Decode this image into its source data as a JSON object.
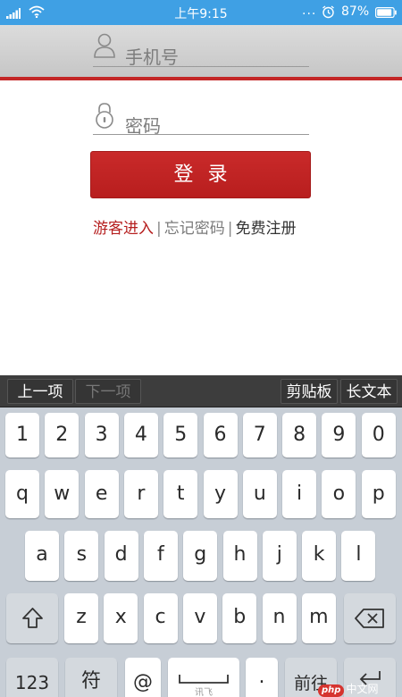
{
  "status_bar": {
    "time": "上午9:15",
    "dots": "...",
    "battery": "87%"
  },
  "form": {
    "phone_placeholder": "手机号",
    "password_placeholder": "密码",
    "login_label": "登录",
    "guest_link": "游客进入",
    "separator": "|",
    "forgot_link": "忘记密码",
    "register_link": "免费注册"
  },
  "toolbar": {
    "prev": "上一项",
    "next": "下一项",
    "clipboard": "剪贴板",
    "long_text": "长文本"
  },
  "keyboard": {
    "row_numbers": [
      "1",
      "2",
      "3",
      "4",
      "5",
      "6",
      "7",
      "8",
      "9",
      "0"
    ],
    "row_q": [
      "q",
      "w",
      "e",
      "r",
      "t",
      "y",
      "u",
      "i",
      "o",
      "p"
    ],
    "row_a": [
      "a",
      "s",
      "d",
      "f",
      "g",
      "h",
      "j",
      "k",
      "l"
    ],
    "row_z": [
      "z",
      "x",
      "c",
      "v",
      "b",
      "n",
      "m"
    ],
    "bottom": {
      "numbers": "123",
      "symbols": "符",
      "at": "@",
      "space_hint": "讯飞",
      "period": ".",
      "go": "前往"
    }
  },
  "watermark": {
    "brand": "php",
    "site": "中文网"
  },
  "colors": {
    "status_bar": "#3fa0e4",
    "accent_red": "#c42727",
    "keyboard_bg": "#c7ced6"
  }
}
